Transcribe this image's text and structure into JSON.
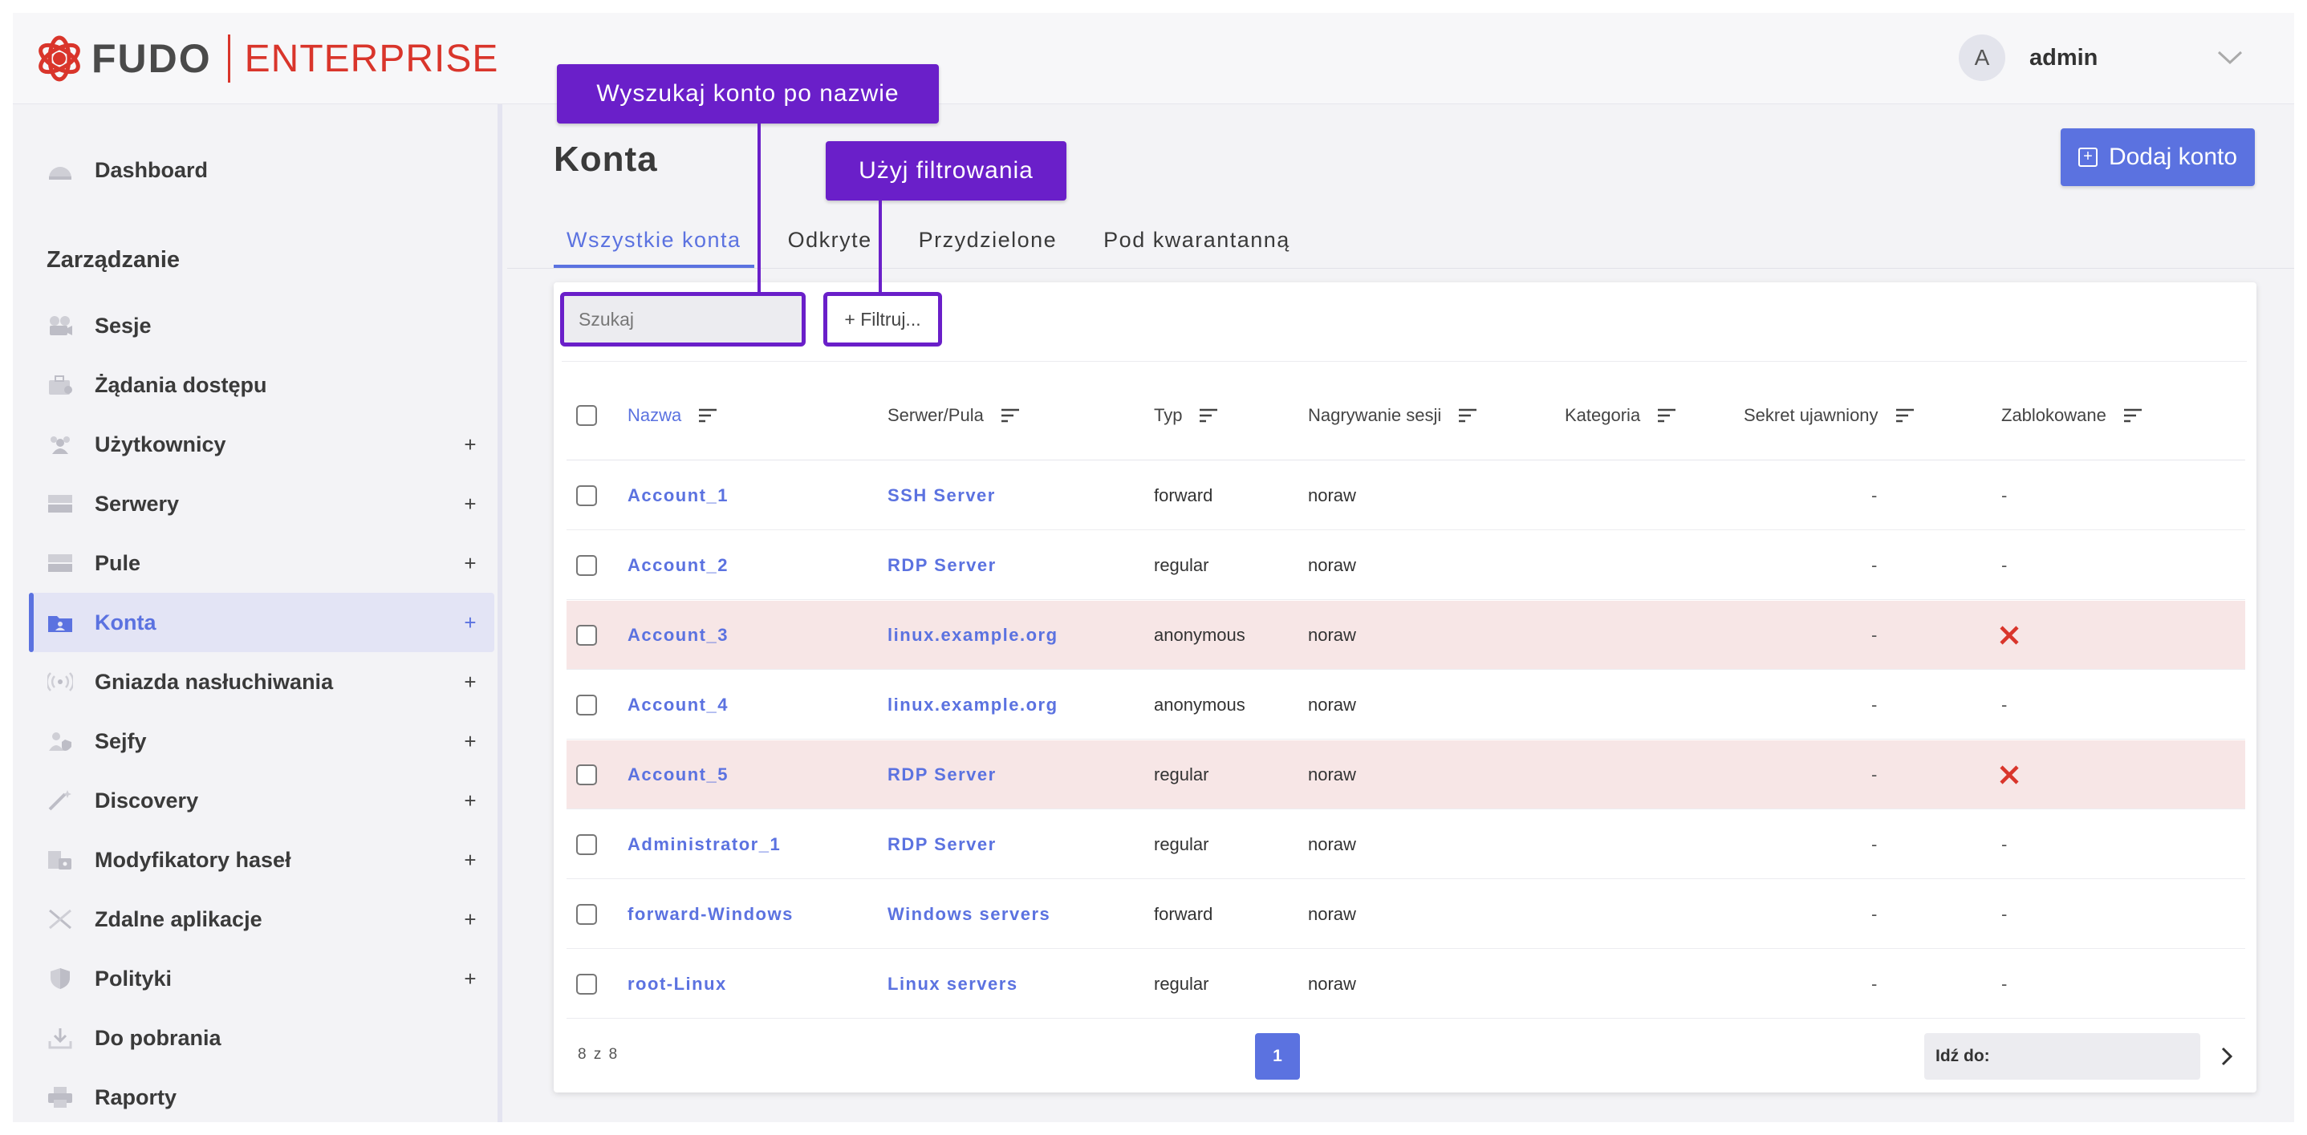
{
  "header": {
    "logo_left": "FUDO",
    "logo_right": "ENTERPRISE",
    "user_initial": "A",
    "user_name": "admin",
    "icons": {
      "logo": "fudo-logo-icon",
      "menu": "chevron-down-icon"
    }
  },
  "sidebar": {
    "dashboard": "Dashboard",
    "section_title": "Zarządzanie",
    "items": [
      {
        "label": "Sesje",
        "icon": "camera-icon",
        "plus": ""
      },
      {
        "label": "Żądania dostępu",
        "icon": "briefcase-icon",
        "plus": ""
      },
      {
        "label": "Użytkownicy",
        "icon": "users-icon",
        "plus": "+"
      },
      {
        "label": "Serwery",
        "icon": "server-icon",
        "plus": "+"
      },
      {
        "label": "Pule",
        "icon": "pool-icon",
        "plus": "+"
      },
      {
        "label": "Konta",
        "icon": "account-folder-icon",
        "plus": "+"
      },
      {
        "label": "Gniazda nasłuchiwania",
        "icon": "listener-icon",
        "plus": "+"
      },
      {
        "label": "Sejfy",
        "icon": "safe-icon",
        "plus": "+"
      },
      {
        "label": "Discovery",
        "icon": "wand-icon",
        "plus": "+"
      },
      {
        "label": "Modyfikatory haseł",
        "icon": "password-modifier-icon",
        "plus": "+"
      },
      {
        "label": "Zdalne aplikacje",
        "icon": "remote-app-icon",
        "plus": "+"
      },
      {
        "label": "Polityki",
        "icon": "shield-icon",
        "plus": "+"
      },
      {
        "label": "Do pobrania",
        "icon": "download-icon",
        "plus": ""
      },
      {
        "label": "Raporty",
        "icon": "printer-icon",
        "plus": ""
      }
    ]
  },
  "main": {
    "title": "Konta",
    "add_button": "Dodaj konto",
    "tabs": [
      "Wszystkie konta",
      "Odkryte",
      "Przydzielone",
      "Pod kwarantanną"
    ],
    "search_placeholder": "Szukaj",
    "filter_label": "+ Filtruj...",
    "columns": [
      "Nazwa",
      "Serwer/Pula",
      "Typ",
      "Nagrywanie sesji",
      "Kategoria",
      "Sekret ujawniony",
      "Zablokowane"
    ],
    "rows": [
      {
        "name": "Account_1",
        "server": "SSH Server",
        "type": "forward",
        "recording": "noraw",
        "category": "",
        "secret": "-",
        "blocked": "-",
        "is_blocked": false
      },
      {
        "name": "Account_2",
        "server": "RDP Server",
        "type": "regular",
        "recording": "noraw",
        "category": "",
        "secret": "-",
        "blocked": "-",
        "is_blocked": false
      },
      {
        "name": "Account_3",
        "server": "linux.example.org",
        "type": "anonymous",
        "recording": "noraw",
        "category": "",
        "secret": "-",
        "blocked": "",
        "is_blocked": true
      },
      {
        "name": "Account_4",
        "server": "linux.example.org",
        "type": "anonymous",
        "recording": "noraw",
        "category": "",
        "secret": "-",
        "blocked": "-",
        "is_blocked": false
      },
      {
        "name": "Account_5",
        "server": "RDP Server",
        "type": "regular",
        "recording": "noraw",
        "category": "",
        "secret": "-",
        "blocked": "",
        "is_blocked": true
      },
      {
        "name": "Administrator_1",
        "server": "RDP Server",
        "type": "regular",
        "recording": "noraw",
        "category": "",
        "secret": "-",
        "blocked": "-",
        "is_blocked": false
      },
      {
        "name": "forward-Windows",
        "server": "Windows servers",
        "type": "forward",
        "recording": "noraw",
        "category": "",
        "secret": "-",
        "blocked": "-",
        "is_blocked": false
      },
      {
        "name": "root-Linux",
        "server": "Linux servers",
        "type": "regular",
        "recording": "noraw",
        "category": "",
        "secret": "-",
        "blocked": "-",
        "is_blocked": false
      }
    ],
    "count_label": "8 z 8",
    "current_page": "1",
    "goto_label": "Idź do:"
  },
  "annotations": {
    "search_callout": "Wyszukaj konto po nazwie",
    "filter_callout": "Użyj filtrowania"
  },
  "colors": {
    "accent": "#5b72e0",
    "callout": "#6a1fc9",
    "blocked_row": "#f7e6e6",
    "blocked_mark": "#d9352b",
    "brand": "#d9352b"
  }
}
